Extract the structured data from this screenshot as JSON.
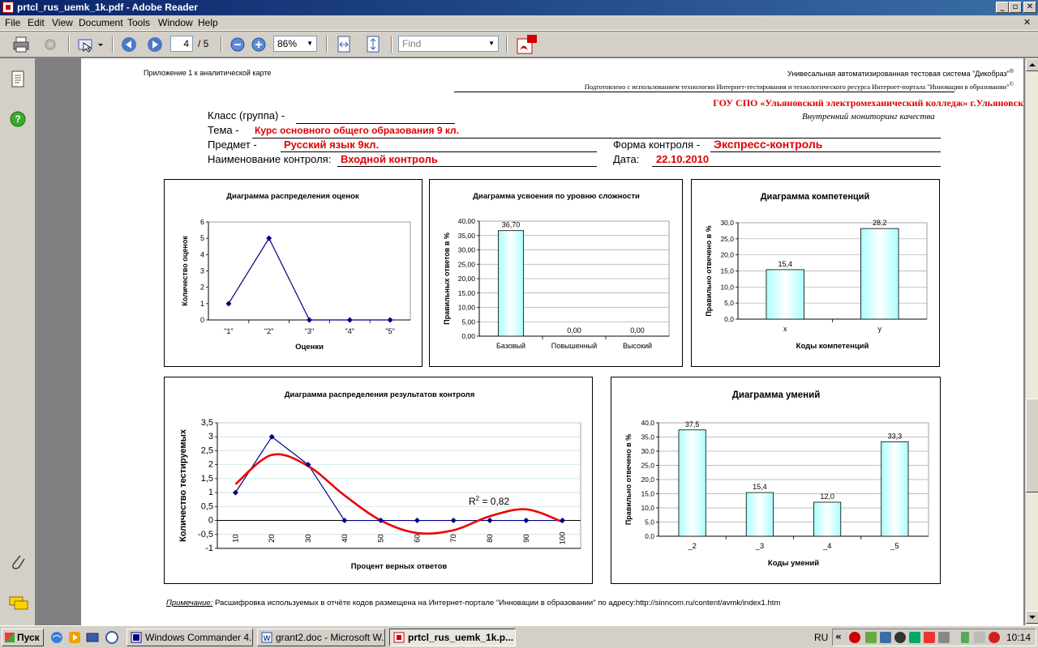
{
  "window": {
    "title": "prtcl_rus_uemk_1k.pdf - Adobe Reader"
  },
  "menu": [
    "File",
    "Edit",
    "View",
    "Document",
    "Tools",
    "Window",
    "Help"
  ],
  "toolbar": {
    "page_current": "4",
    "page_total": "/ 5",
    "zoom": "86%",
    "find_placeholder": "Find"
  },
  "doc": {
    "appendix": "Приложение 1 к аналитической карте",
    "system_line": "Унивесальная автоматизированная тестовая система \"Дикобраз\"",
    "prepared_line": "Подготовлено с использованием технологии Интернет-тестирования и технологического ресурса  Интернет-портала \"Инновации в образовании\"",
    "org": "ГОУ СПО «Ульяновский электромеханический колледж» г.Ульяновск",
    "monitoring": "Внутренний мониторинг  качества",
    "class_label": "Класс (группа) -",
    "topic_label": "Тема -",
    "topic_value": "Курс основного общего образования 9 кл.",
    "subject_label": "Предмет  -",
    "subject_value": "Русский язык 9кл.",
    "control_name_label": "Наименование контроля:",
    "control_name_value": "Входной контроль",
    "form_label": "Форма контроля -",
    "form_value": "Экспресс-контроль",
    "date_label": "Дата:",
    "date_value": "22.10.2010",
    "note_label": "Примечание:",
    "note_text": " Расшифровка используемых в отчёте кодов размещена на Интернет-портале \"Инновации в образовании\" по адресу:http://sinncom.ru/content/avmk/index1.htm"
  },
  "taskbar": {
    "start": "Пуск",
    "tasks": [
      "Windows Commander 4....",
      "grant2.doc - Microsoft W...",
      "prtcl_rus_uemk_1k.p..."
    ],
    "lang": "RU",
    "clock": "10:14"
  },
  "colors": {
    "accent_red": "#e00000",
    "bar_fill": "#ccffff",
    "line_navy": "#000080",
    "trend_red": "#ee0000"
  },
  "chart_data": [
    {
      "type": "line",
      "title": "Диаграмма распределения оценок",
      "xlabel": "Оценки",
      "ylabel": "Количество оценок",
      "categories": [
        "\"1\"",
        "\"2\"",
        "\"3\"",
        "\"4\"",
        "\"5\""
      ],
      "values": [
        1,
        5,
        0,
        0,
        0
      ],
      "ylim": [
        0,
        6
      ],
      "yticks": [
        "0",
        "1",
        "2",
        "3",
        "4",
        "5",
        "6"
      ]
    },
    {
      "type": "bar",
      "title": "Диаграмма усвоения по уровню сложности",
      "xlabel": "",
      "ylabel": "Правильных ответов в %",
      "categories": [
        "Базовый",
        "Повышенный",
        "Высокий"
      ],
      "values": [
        36.7,
        0,
        0
      ],
      "labels": [
        "36,70",
        "0,00",
        "0,00"
      ],
      "ylim": [
        0,
        40
      ],
      "yticks": [
        "0,00",
        "5,00",
        "10,00",
        "15,00",
        "20,00",
        "25,00",
        "30,00",
        "35,00",
        "40,00"
      ]
    },
    {
      "type": "bar",
      "title": "Диаграмма компетенций",
      "xlabel": "Коды компетенций",
      "ylabel": "Правильно отвечено в %",
      "categories": [
        "x",
        "y"
      ],
      "values": [
        15.4,
        28.2
      ],
      "labels": [
        "15,4",
        "28,2"
      ],
      "ylim": [
        0,
        30
      ],
      "yticks": [
        "0,0",
        "5,0",
        "10,0",
        "15,0",
        "20,0",
        "25,0",
        "30,0"
      ]
    },
    {
      "type": "line",
      "title": "Диаграмма распределения результатов контроля",
      "xlabel": "Процент верных ответов",
      "ylabel": "Количество тестируемых",
      "categories": [
        "10",
        "20",
        "30",
        "40",
        "50",
        "60",
        "70",
        "80",
        "90",
        "100"
      ],
      "values": [
        1,
        3,
        2,
        0,
        0,
        0,
        0,
        0,
        0,
        0
      ],
      "trend_points": [
        [
          10,
          1.3
        ],
        [
          20,
          2.35
        ],
        [
          30,
          1.95
        ],
        [
          40,
          0.9
        ],
        [
          50,
          0.0
        ],
        [
          60,
          -0.45
        ],
        [
          70,
          -0.35
        ],
        [
          80,
          0.15
        ],
        [
          90,
          0.4
        ],
        [
          100,
          -0.05
        ]
      ],
      "annotation_r": "R",
      "annotation_sup": "2",
      "annotation_val": " = 0,82",
      "ylim": [
        -1,
        3.5
      ],
      "yticks": [
        "-1",
        "-0,5",
        "0",
        "0,5",
        "1",
        "1,5",
        "2",
        "2,5",
        "3",
        "3,5"
      ]
    },
    {
      "type": "bar",
      "title": "Диаграмма умений",
      "xlabel": "Коды умений",
      "ylabel": "Правильно отвечено в %",
      "categories": [
        "_2",
        "_3",
        "_4",
        "_5"
      ],
      "values": [
        37.5,
        15.4,
        12.0,
        33.3
      ],
      "labels": [
        "37,5",
        "15,4",
        "12,0",
        "33,3"
      ],
      "ylim": [
        0,
        40
      ],
      "yticks": [
        "0,0",
        "5,0",
        "10,0",
        "15,0",
        "20,0",
        "25,0",
        "30,0",
        "35,0",
        "40,0"
      ]
    }
  ]
}
